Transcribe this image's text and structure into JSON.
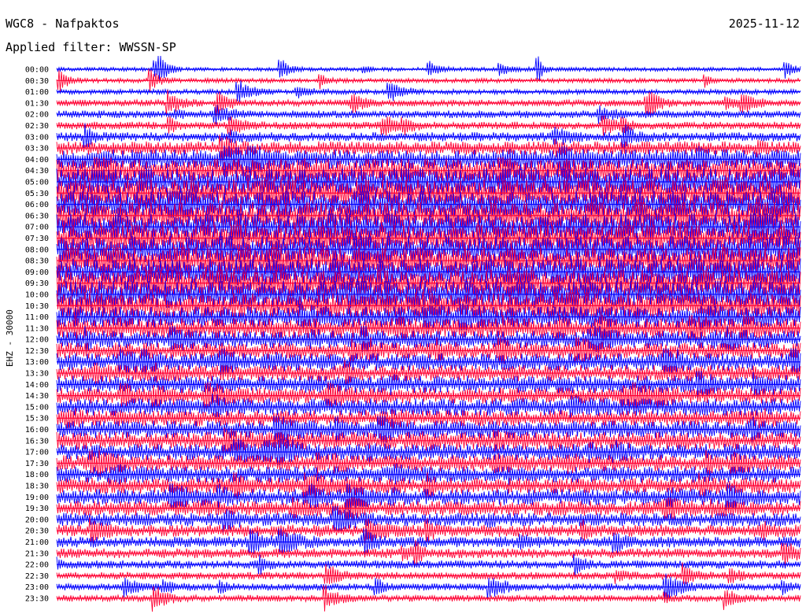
{
  "header": {
    "station": "WGC8 - Nafpaktos",
    "date": "2025-11-12",
    "filter": "Applied filter: WWSSN-SP"
  },
  "chart_data": {
    "type": "helicorder",
    "channel_label": "EHZ - 30000",
    "colors": [
      "#0000ff",
      "#ff0033"
    ],
    "row_labels": [
      "00:00",
      "00:30",
      "01:00",
      "01:30",
      "02:00",
      "02:30",
      "03:00",
      "03:30",
      "04:00",
      "04:30",
      "05:00",
      "05:30",
      "06:00",
      "06:30",
      "07:00",
      "07:30",
      "08:00",
      "08:30",
      "09:00",
      "09:30",
      "10:00",
      "10:30",
      "11:00",
      "11:30",
      "12:00",
      "12:30",
      "13:00",
      "13:30",
      "14:00",
      "14:30",
      "15:00",
      "15:30",
      "16:00",
      "16:30",
      "17:00",
      "17:30",
      "18:00",
      "18:30",
      "19:00",
      "19:30",
      "20:00",
      "20:30",
      "21:00",
      "21:30",
      "22:00",
      "22:30",
      "23:00",
      "23:30"
    ],
    "noise_level": [
      0.08,
      0.1,
      0.12,
      0.18,
      0.22,
      0.22,
      0.28,
      0.45,
      0.7,
      0.85,
      1.0,
      1.0,
      1.0,
      1.0,
      1.0,
      1.0,
      1.0,
      1.0,
      1.0,
      1.0,
      1.0,
      0.9,
      0.75,
      0.7,
      0.6,
      0.55,
      0.6,
      0.55,
      0.6,
      0.55,
      0.6,
      0.55,
      0.6,
      0.6,
      0.55,
      0.55,
      0.55,
      0.55,
      0.55,
      0.5,
      0.45,
      0.4,
      0.35,
      0.3,
      0.25,
      0.22,
      0.2,
      0.18
    ]
  }
}
